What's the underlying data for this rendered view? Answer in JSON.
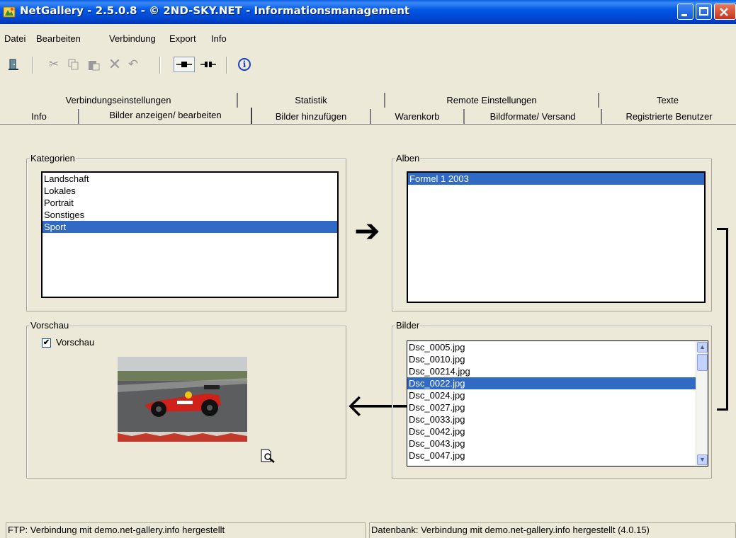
{
  "window": {
    "title": "NetGallery - 2.5.0.8 - © 2ND-SKY.NET - Informationsmanagement"
  },
  "menu": [
    "Datei",
    "Bearbeiten",
    "Verbindung",
    "Export",
    "Info"
  ],
  "toolbar": {
    "icons": [
      "exit-icon",
      "cut-icon",
      "copy-icon",
      "paste-icon",
      "delete-icon",
      "undo-icon",
      "connect-icon",
      "disconnect-icon",
      "info-icon"
    ],
    "info_glyph": "i"
  },
  "tabs": {
    "back_row": [
      "Verbindungseinstellungen",
      "Statistik",
      "Remote Einstellungen",
      "Texte"
    ],
    "front_row": [
      "Info",
      "Bilder anzeigen/ bearbeiten",
      "Bilder hinzufügen",
      "Warenkorb",
      "Bildformate/ Versand",
      "Registrierte Benutzer"
    ],
    "active": "Bilder anzeigen/ bearbeiten"
  },
  "kategorien": {
    "label": "Kategorien",
    "items": [
      "Landschaft",
      "Lokales",
      "Portrait",
      "Sonstiges",
      "Sport"
    ],
    "selected": "Sport"
  },
  "alben": {
    "label": "Alben",
    "items": [
      "Formel 1 2003"
    ],
    "selected": "Formel 1 2003"
  },
  "bilder": {
    "label": "Bilder",
    "items": [
      "Dsc_0005.jpg",
      "Dsc_0010.jpg",
      "Dsc_00214.jpg",
      "Dsc_0022.jpg",
      "Dsc_0024.jpg",
      "Dsc_0027.jpg",
      "Dsc_0033.jpg",
      "Dsc_0042.jpg",
      "Dsc_0043.jpg",
      "Dsc_0047.jpg"
    ],
    "selected": "Dsc_0022.jpg"
  },
  "vorschau": {
    "label": "Vorschau",
    "checkbox_label": "Vorschau",
    "checked": true,
    "check_glyph": "✔"
  },
  "status": {
    "ftp": "FTP: Verbindung mit demo.net-gallery.info hergestellt",
    "db": "Datenbank: Verbindung mit demo.net-gallery.info hergestellt (4.0.15)"
  },
  "arrows": {
    "right": "➔",
    "left": "🡐"
  },
  "colors": {
    "titlebar": "#0058e6",
    "selection": "#316ac5",
    "window_bg": "#ece9d8"
  }
}
